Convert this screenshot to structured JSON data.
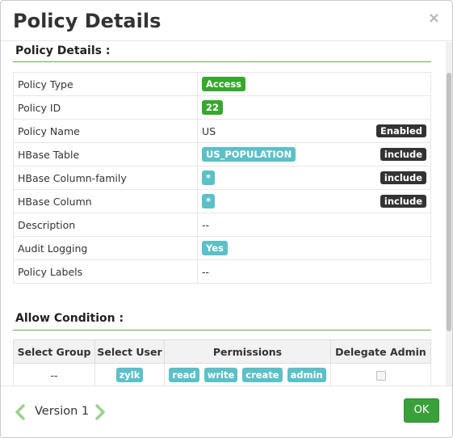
{
  "header": {
    "title": "Policy Details",
    "close_label": "×"
  },
  "details": {
    "section_title": "Policy Details :",
    "rows": {
      "policy_type": {
        "label": "Policy Type",
        "value": "Access"
      },
      "policy_id": {
        "label": "Policy ID",
        "value": "22"
      },
      "policy_name": {
        "label": "Policy Name",
        "value": "US",
        "status": "Enabled"
      },
      "hbase_table": {
        "label": "HBase Table",
        "value": "US_POPULATION",
        "mode": "include"
      },
      "hbase_column_family": {
        "label": "HBase Column-family",
        "value": "*",
        "mode": "include"
      },
      "hbase_column": {
        "label": "HBase Column",
        "value": "*",
        "mode": "include"
      },
      "description": {
        "label": "Description",
        "value": "--"
      },
      "audit_logging": {
        "label": "Audit Logging",
        "value": "Yes"
      },
      "policy_labels": {
        "label": "Policy Labels",
        "value": "--"
      }
    }
  },
  "allow": {
    "section_title": "Allow Condition :",
    "headers": {
      "group": "Select Group",
      "user": "Select User",
      "permissions": "Permissions",
      "delegate": "Delegate Admin"
    },
    "row": {
      "group": "--",
      "user": "zylk",
      "permissions": [
        "read",
        "write",
        "create",
        "admin"
      ],
      "delegate_checked": false
    }
  },
  "footer": {
    "version_label": "Version 1",
    "ok_label": "OK"
  },
  "colors": {
    "accent_green": "#37a82e",
    "teal": "#5bc0c8",
    "dark_badge": "#333333",
    "rule_green": "#6aa84f"
  }
}
